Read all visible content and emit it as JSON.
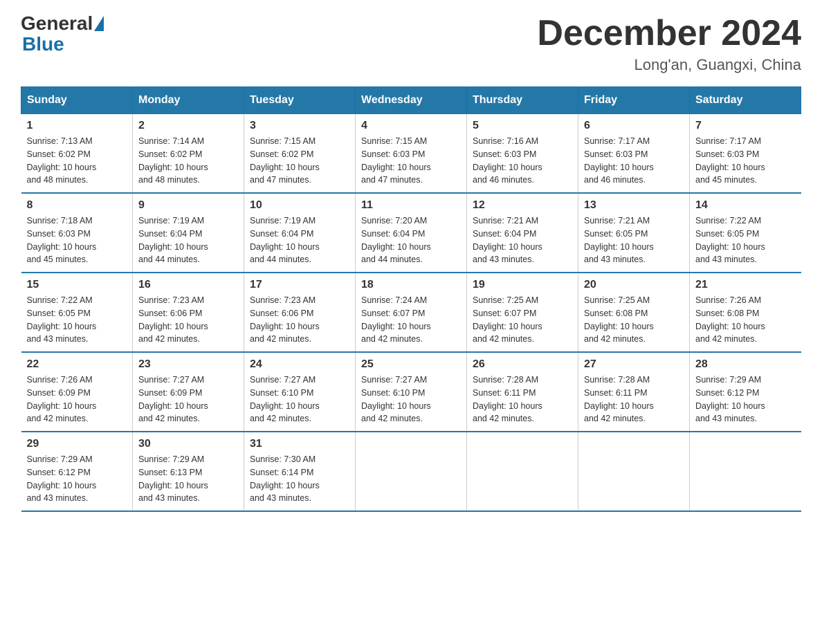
{
  "header": {
    "logo_general": "General",
    "logo_blue": "Blue",
    "month_title": "December 2024",
    "location": "Long'an, Guangxi, China"
  },
  "days_of_week": [
    "Sunday",
    "Monday",
    "Tuesday",
    "Wednesday",
    "Thursday",
    "Friday",
    "Saturday"
  ],
  "weeks": [
    [
      {
        "day": "1",
        "sunrise": "7:13 AM",
        "sunset": "6:02 PM",
        "daylight": "10 hours and 48 minutes."
      },
      {
        "day": "2",
        "sunrise": "7:14 AM",
        "sunset": "6:02 PM",
        "daylight": "10 hours and 48 minutes."
      },
      {
        "day": "3",
        "sunrise": "7:15 AM",
        "sunset": "6:02 PM",
        "daylight": "10 hours and 47 minutes."
      },
      {
        "day": "4",
        "sunrise": "7:15 AM",
        "sunset": "6:03 PM",
        "daylight": "10 hours and 47 minutes."
      },
      {
        "day": "5",
        "sunrise": "7:16 AM",
        "sunset": "6:03 PM",
        "daylight": "10 hours and 46 minutes."
      },
      {
        "day": "6",
        "sunrise": "7:17 AM",
        "sunset": "6:03 PM",
        "daylight": "10 hours and 46 minutes."
      },
      {
        "day": "7",
        "sunrise": "7:17 AM",
        "sunset": "6:03 PM",
        "daylight": "10 hours and 45 minutes."
      }
    ],
    [
      {
        "day": "8",
        "sunrise": "7:18 AM",
        "sunset": "6:03 PM",
        "daylight": "10 hours and 45 minutes."
      },
      {
        "day": "9",
        "sunrise": "7:19 AM",
        "sunset": "6:04 PM",
        "daylight": "10 hours and 44 minutes."
      },
      {
        "day": "10",
        "sunrise": "7:19 AM",
        "sunset": "6:04 PM",
        "daylight": "10 hours and 44 minutes."
      },
      {
        "day": "11",
        "sunrise": "7:20 AM",
        "sunset": "6:04 PM",
        "daylight": "10 hours and 44 minutes."
      },
      {
        "day": "12",
        "sunrise": "7:21 AM",
        "sunset": "6:04 PM",
        "daylight": "10 hours and 43 minutes."
      },
      {
        "day": "13",
        "sunrise": "7:21 AM",
        "sunset": "6:05 PM",
        "daylight": "10 hours and 43 minutes."
      },
      {
        "day": "14",
        "sunrise": "7:22 AM",
        "sunset": "6:05 PM",
        "daylight": "10 hours and 43 minutes."
      }
    ],
    [
      {
        "day": "15",
        "sunrise": "7:22 AM",
        "sunset": "6:05 PM",
        "daylight": "10 hours and 43 minutes."
      },
      {
        "day": "16",
        "sunrise": "7:23 AM",
        "sunset": "6:06 PM",
        "daylight": "10 hours and 42 minutes."
      },
      {
        "day": "17",
        "sunrise": "7:23 AM",
        "sunset": "6:06 PM",
        "daylight": "10 hours and 42 minutes."
      },
      {
        "day": "18",
        "sunrise": "7:24 AM",
        "sunset": "6:07 PM",
        "daylight": "10 hours and 42 minutes."
      },
      {
        "day": "19",
        "sunrise": "7:25 AM",
        "sunset": "6:07 PM",
        "daylight": "10 hours and 42 minutes."
      },
      {
        "day": "20",
        "sunrise": "7:25 AM",
        "sunset": "6:08 PM",
        "daylight": "10 hours and 42 minutes."
      },
      {
        "day": "21",
        "sunrise": "7:26 AM",
        "sunset": "6:08 PM",
        "daylight": "10 hours and 42 minutes."
      }
    ],
    [
      {
        "day": "22",
        "sunrise": "7:26 AM",
        "sunset": "6:09 PM",
        "daylight": "10 hours and 42 minutes."
      },
      {
        "day": "23",
        "sunrise": "7:27 AM",
        "sunset": "6:09 PM",
        "daylight": "10 hours and 42 minutes."
      },
      {
        "day": "24",
        "sunrise": "7:27 AM",
        "sunset": "6:10 PM",
        "daylight": "10 hours and 42 minutes."
      },
      {
        "day": "25",
        "sunrise": "7:27 AM",
        "sunset": "6:10 PM",
        "daylight": "10 hours and 42 minutes."
      },
      {
        "day": "26",
        "sunrise": "7:28 AM",
        "sunset": "6:11 PM",
        "daylight": "10 hours and 42 minutes."
      },
      {
        "day": "27",
        "sunrise": "7:28 AM",
        "sunset": "6:11 PM",
        "daylight": "10 hours and 42 minutes."
      },
      {
        "day": "28",
        "sunrise": "7:29 AM",
        "sunset": "6:12 PM",
        "daylight": "10 hours and 43 minutes."
      }
    ],
    [
      {
        "day": "29",
        "sunrise": "7:29 AM",
        "sunset": "6:12 PM",
        "daylight": "10 hours and 43 minutes."
      },
      {
        "day": "30",
        "sunrise": "7:29 AM",
        "sunset": "6:13 PM",
        "daylight": "10 hours and 43 minutes."
      },
      {
        "day": "31",
        "sunrise": "7:30 AM",
        "sunset": "6:14 PM",
        "daylight": "10 hours and 43 minutes."
      },
      {
        "day": "",
        "sunrise": "",
        "sunset": "",
        "daylight": ""
      },
      {
        "day": "",
        "sunrise": "",
        "sunset": "",
        "daylight": ""
      },
      {
        "day": "",
        "sunrise": "",
        "sunset": "",
        "daylight": ""
      },
      {
        "day": "",
        "sunrise": "",
        "sunset": "",
        "daylight": ""
      }
    ]
  ],
  "labels": {
    "sunrise_prefix": "Sunrise: ",
    "sunset_prefix": "Sunset: ",
    "daylight_prefix": "Daylight: "
  }
}
